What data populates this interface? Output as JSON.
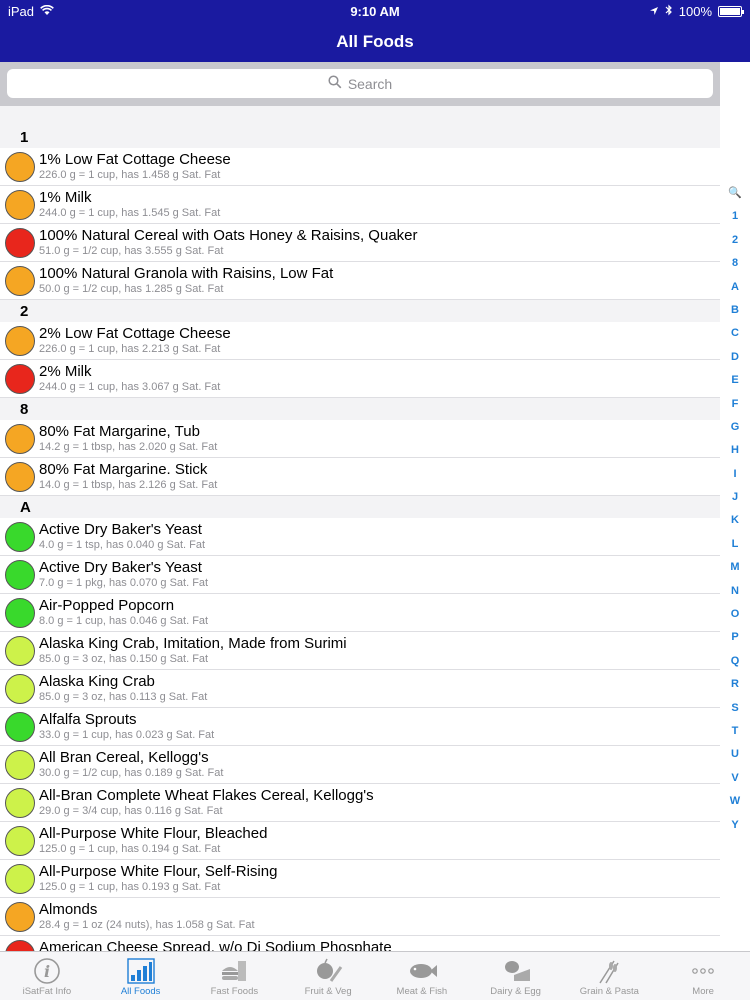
{
  "status": {
    "device": "iPad",
    "time": "9:10 AM",
    "battery": "100%"
  },
  "nav": {
    "title": "All Foods"
  },
  "search": {
    "placeholder": "Search"
  },
  "colors": {
    "orange": "#f5a623",
    "red": "#e8261c",
    "green": "#39d92c",
    "lime": "#cdf24a"
  },
  "list": [
    {
      "type": "header",
      "label": "1"
    },
    {
      "type": "item",
      "title": "1% Low Fat Cottage Cheese",
      "sub": "226.0 g = 1 cup, has 1.458 g Sat. Fat",
      "color": "orange"
    },
    {
      "type": "item",
      "title": "1% Milk",
      "sub": "244.0 g = 1 cup, has 1.545 g Sat. Fat",
      "color": "orange"
    },
    {
      "type": "item",
      "title": "100% Natural Cereal with Oats Honey & Raisins, Quaker",
      "sub": "51.0 g = 1/2 cup, has 3.555 g Sat. Fat",
      "color": "red"
    },
    {
      "type": "item",
      "title": "100% Natural Granola with Raisins, Low Fat",
      "sub": "50.0 g = 1/2 cup, has 1.285 g Sat. Fat",
      "color": "orange"
    },
    {
      "type": "header",
      "label": "2"
    },
    {
      "type": "item",
      "title": "2% Low Fat Cottage Cheese",
      "sub": "226.0 g = 1 cup, has 2.213 g Sat. Fat",
      "color": "orange"
    },
    {
      "type": "item",
      "title": "2% Milk",
      "sub": "244.0 g = 1 cup, has 3.067 g Sat. Fat",
      "color": "red"
    },
    {
      "type": "header",
      "label": "8"
    },
    {
      "type": "item",
      "title": "80% Fat Margarine, Tub",
      "sub": "14.2 g = 1 tbsp, has 2.020 g Sat. Fat",
      "color": "orange"
    },
    {
      "type": "item",
      "title": "80% Fat Margarine. Stick",
      "sub": "14.0 g = 1 tbsp, has 2.126 g Sat. Fat",
      "color": "orange"
    },
    {
      "type": "header",
      "label": "A"
    },
    {
      "type": "item",
      "title": "Active Dry Baker's Yeast",
      "sub": "4.0 g = 1 tsp, has 0.040 g Sat. Fat",
      "color": "green"
    },
    {
      "type": "item",
      "title": "Active Dry Baker's Yeast",
      "sub": "7.0 g = 1 pkg, has 0.070 g Sat. Fat",
      "color": "green"
    },
    {
      "type": "item",
      "title": "Air-Popped Popcorn",
      "sub": "8.0 g = 1 cup, has 0.046 g Sat. Fat",
      "color": "green"
    },
    {
      "type": "item",
      "title": "Alaska King Crab, Imitation, Made from Surimi",
      "sub": "85.0 g = 3 oz, has 0.150 g Sat. Fat",
      "color": "lime"
    },
    {
      "type": "item",
      "title": "Alaska King Crab",
      "sub": "85.0 g = 3 oz, has 0.113 g Sat. Fat",
      "color": "lime"
    },
    {
      "type": "item",
      "title": "Alfalfa Sprouts",
      "sub": "33.0 g = 1 cup, has 0.023 g Sat. Fat",
      "color": "green"
    },
    {
      "type": "item",
      "title": "All Bran Cereal, Kellogg's",
      "sub": "30.0 g = 1/2 cup, has 0.189 g Sat. Fat",
      "color": "lime"
    },
    {
      "type": "item",
      "title": "All-Bran Complete Wheat Flakes Cereal, Kellogg's",
      "sub": "29.0 g = 3/4 cup, has 0.116 g Sat. Fat",
      "color": "lime"
    },
    {
      "type": "item",
      "title": "All-Purpose White Flour, Bleached",
      "sub": "125.0 g = 1 cup, has 0.194 g Sat. Fat",
      "color": "lime"
    },
    {
      "type": "item",
      "title": "All-Purpose White Flour, Self-Rising",
      "sub": "125.0 g = 1 cup, has 0.193 g Sat. Fat",
      "color": "lime"
    },
    {
      "type": "item",
      "title": "Almonds",
      "sub": "28.4 g = 1 oz (24 nuts), has 1.058 g Sat. Fat",
      "color": "orange"
    },
    {
      "type": "item",
      "title": "American Cheese Spread, w/o Di Sodium Phosphate",
      "sub": "",
      "color": "red"
    }
  ],
  "index": [
    "🔍",
    "1",
    "2",
    "8",
    "A",
    "B",
    "C",
    "D",
    "E",
    "F",
    "G",
    "H",
    "I",
    "J",
    "K",
    "L",
    "M",
    "N",
    "O",
    "P",
    "Q",
    "R",
    "S",
    "T",
    "U",
    "V",
    "W",
    "Y"
  ],
  "tabs": [
    {
      "label": "iSatFat Info",
      "icon": "info-icon",
      "active": false
    },
    {
      "label": "All Foods",
      "icon": "bar-chart-icon",
      "active": true
    },
    {
      "label": "Fast Foods",
      "icon": "burger-icon",
      "active": false
    },
    {
      "label": "Fruit & Veg",
      "icon": "apple-icon",
      "active": false
    },
    {
      "label": "Meat & Fish",
      "icon": "fish-icon",
      "active": false
    },
    {
      "label": "Dairy & Egg",
      "icon": "cheese-icon",
      "active": false
    },
    {
      "label": "Grain & Pasta",
      "icon": "wheat-icon",
      "active": false
    },
    {
      "label": "More",
      "icon": "more-icon",
      "active": false
    }
  ]
}
